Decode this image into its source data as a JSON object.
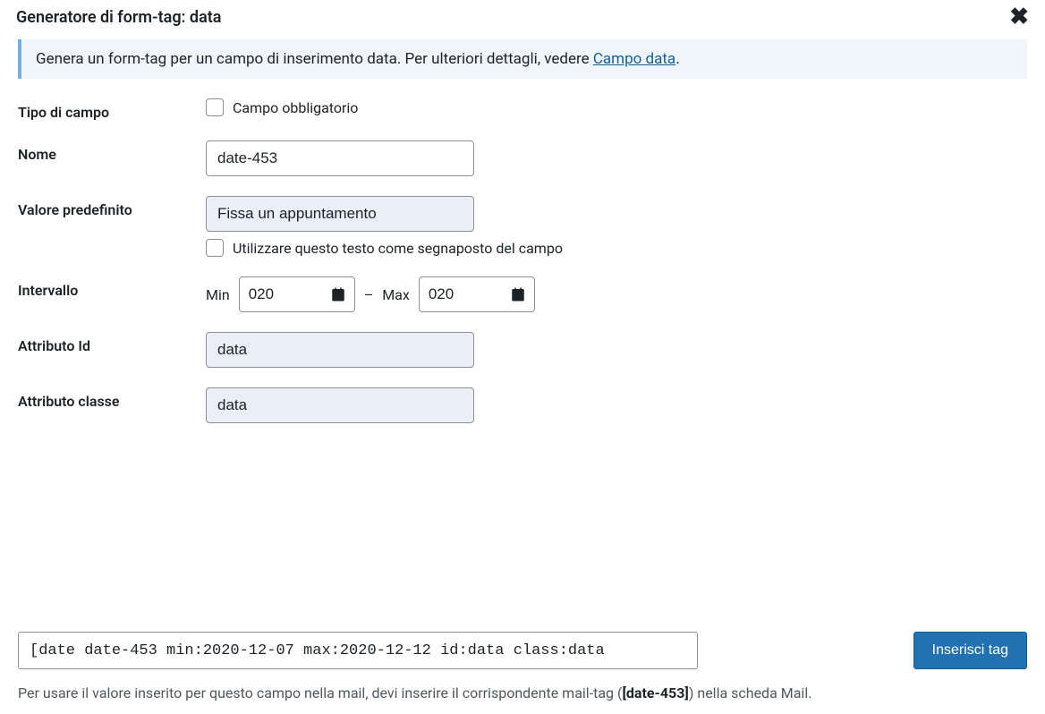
{
  "header": {
    "title": "Generatore di form-tag: data"
  },
  "notice": {
    "text_before_link": "Genera un form-tag per un campo di inserimento data. Per ulteriori dettagli, vedere ",
    "link_text": "Campo data",
    "text_after_link": "."
  },
  "fields": {
    "field_type": {
      "label": "Tipo di campo",
      "required_label": "Campo obbligatorio"
    },
    "name": {
      "label": "Nome",
      "value": "date-453"
    },
    "default_value": {
      "label": "Valore predefinito",
      "value": "Fissa un appuntamento",
      "placeholder_option_label": "Utilizzare questo testo come segnaposto del campo"
    },
    "range": {
      "label": "Intervallo",
      "min_label": "Min",
      "min_value": "020",
      "separator": "–",
      "max_label": "Max",
      "max_value": "020"
    },
    "id_attr": {
      "label": "Attributo Id",
      "value": "data"
    },
    "class_attr": {
      "label": "Attributo classe",
      "value": "data"
    }
  },
  "output": {
    "tag": "[date date-453 min:2020-12-07 max:2020-12-12 id:data class:data",
    "insert_button": "Inserisci tag"
  },
  "footer": {
    "text_before": "Per usare il valore inserito per questo campo nella mail, devi inserire il corrispondente mail-tag (",
    "bold": "[date-453]",
    "text_after": ") nella scheda Mail."
  }
}
